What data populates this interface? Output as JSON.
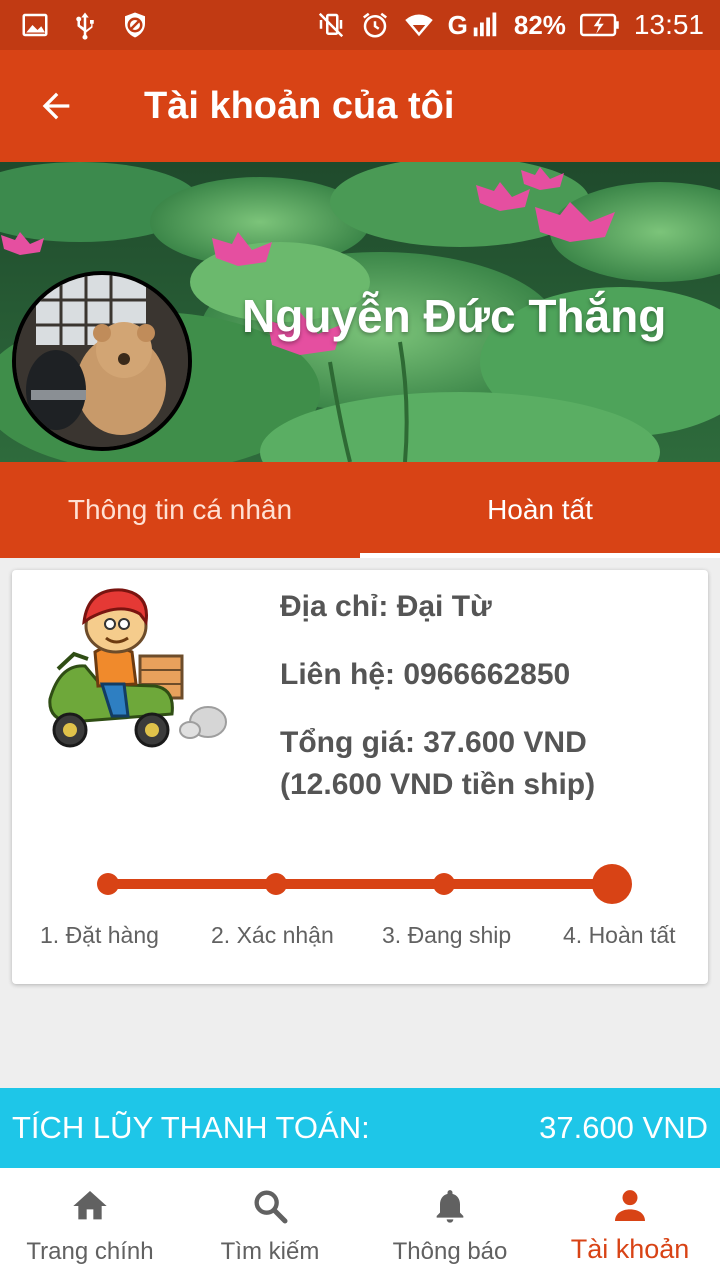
{
  "status_bar": {
    "battery": "82%",
    "time": "13:51",
    "network": "G",
    "icons_left": [
      "gallery-icon",
      "usb-icon",
      "blocked-icon"
    ],
    "icons_right": [
      "mute-icon",
      "alarm-icon",
      "wifi-icon",
      "signal-icon",
      "battery-icon"
    ]
  },
  "app_bar": {
    "title": "Tài khoản của tôi",
    "back_icon": "arrow-back-icon"
  },
  "profile": {
    "name": "Nguyễn Đức Thắng"
  },
  "tabs": [
    {
      "label": "Thông tin cá nhân",
      "selected": false
    },
    {
      "label": "Hoàn tất",
      "selected": true
    }
  ],
  "order": {
    "address": "Địa chỉ: Đại Từ",
    "contact": "Liên hệ: 0966662850",
    "total": "Tổng giá: 37.600 VND",
    "shipping": "(12.600 VND tiền ship)",
    "steps": [
      "1. Đặt hàng",
      "2. Xác nhận",
      "3. Đang ship",
      "4. Hoàn tất"
    ],
    "current_step": 4
  },
  "accumulated": {
    "label": "TÍCH LŨY THANH TOÁN:",
    "value": "37.600 VND"
  },
  "bottom_nav": [
    {
      "label": "Trang chính",
      "icon": "home-icon",
      "active": false
    },
    {
      "label": "Tìm kiếm",
      "icon": "search-icon",
      "active": false
    },
    {
      "label": "Thông báo",
      "icon": "bell-icon",
      "active": false
    },
    {
      "label": "Tài khoản",
      "icon": "person-icon",
      "active": true
    }
  ],
  "colors": {
    "status_bar": "#c13a13",
    "primary": "#d84315",
    "accent_cyan": "#1ec6e8",
    "text_grey": "#555555",
    "nav_inactive": "#616161"
  }
}
